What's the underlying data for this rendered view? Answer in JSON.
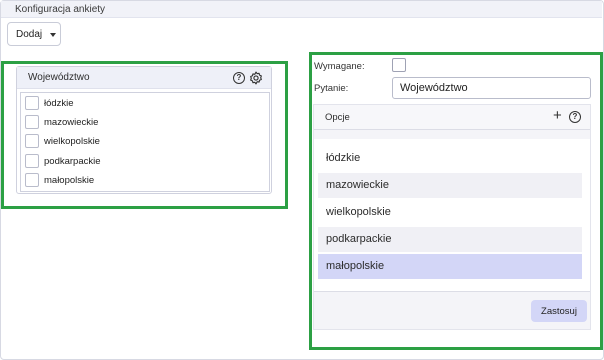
{
  "window": {
    "title": "Konfiguracja ankiety"
  },
  "toolbar": {
    "add_label": "Dodaj"
  },
  "preview": {
    "title": "Województwo",
    "options": [
      "łódzkie",
      "mazowieckie",
      "wielkopolskie",
      "podkarpackie",
      "małopolskie"
    ]
  },
  "editor": {
    "required_label": "Wymagane:",
    "required_checked": false,
    "question_label": "Pytanie:",
    "question_value": "Województwo",
    "options_title": "Opcje",
    "options": [
      "łódzkie",
      "mazowieckie",
      "wielkopolskie",
      "podkarpackie",
      "małopolskie"
    ],
    "selected_option": "małopolskie",
    "apply_label": "Zastosuj"
  },
  "colors": {
    "highlight_border": "#2ca044",
    "selected_item": "#d3d6f7"
  },
  "icons": {
    "help": "question-circle-icon",
    "settings": "gear-icon",
    "add": "plus-icon",
    "dropdown": "caret-down-icon"
  }
}
